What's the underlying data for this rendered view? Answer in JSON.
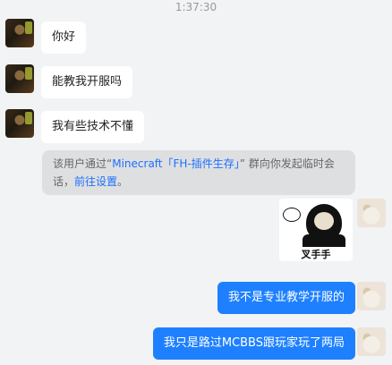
{
  "chat": {
    "timestamp": "1:37:30",
    "incoming": [
      {
        "text": "你好"
      },
      {
        "text": "能教我开服吗"
      },
      {
        "text": "我有些技术不懂"
      }
    ],
    "system_notice": {
      "prefix": "该用户通过",
      "quote_open": "“",
      "group_name": "Minecraft「FH-插件生存」",
      "quote_close": "”",
      "suffix": " 群向你发起临时会话，",
      "link_text": "前往设置",
      "end": "。"
    },
    "sticker": {
      "caption": "叉手手"
    },
    "outgoing": [
      {
        "text": "我不是专业教学开服的"
      },
      {
        "text": "我只是路过MCBBS跟玩家玩了两局"
      }
    ]
  },
  "colors": {
    "background": "#f2f3f5",
    "incoming_bubble": "#ffffff",
    "outgoing_bubble": "#1e80ff",
    "link": "#1e6fff"
  }
}
